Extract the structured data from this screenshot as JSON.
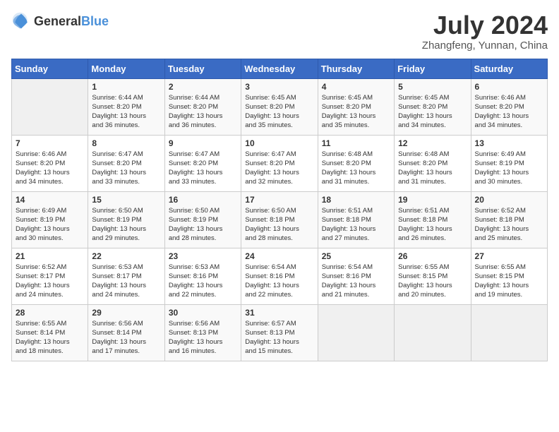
{
  "header": {
    "logo_general": "General",
    "logo_blue": "Blue",
    "month_year": "July 2024",
    "location": "Zhangfeng, Yunnan, China"
  },
  "days_of_week": [
    "Sunday",
    "Monday",
    "Tuesday",
    "Wednesday",
    "Thursday",
    "Friday",
    "Saturday"
  ],
  "weeks": [
    [
      {
        "day": "",
        "info": ""
      },
      {
        "day": "1",
        "info": "Sunrise: 6:44 AM\nSunset: 8:20 PM\nDaylight: 13 hours\nand 36 minutes."
      },
      {
        "day": "2",
        "info": "Sunrise: 6:44 AM\nSunset: 8:20 PM\nDaylight: 13 hours\nand 36 minutes."
      },
      {
        "day": "3",
        "info": "Sunrise: 6:45 AM\nSunset: 8:20 PM\nDaylight: 13 hours\nand 35 minutes."
      },
      {
        "day": "4",
        "info": "Sunrise: 6:45 AM\nSunset: 8:20 PM\nDaylight: 13 hours\nand 35 minutes."
      },
      {
        "day": "5",
        "info": "Sunrise: 6:45 AM\nSunset: 8:20 PM\nDaylight: 13 hours\nand 34 minutes."
      },
      {
        "day": "6",
        "info": "Sunrise: 6:46 AM\nSunset: 8:20 PM\nDaylight: 13 hours\nand 34 minutes."
      }
    ],
    [
      {
        "day": "7",
        "info": "Sunrise: 6:46 AM\nSunset: 8:20 PM\nDaylight: 13 hours\nand 34 minutes."
      },
      {
        "day": "8",
        "info": "Sunrise: 6:47 AM\nSunset: 8:20 PM\nDaylight: 13 hours\nand 33 minutes."
      },
      {
        "day": "9",
        "info": "Sunrise: 6:47 AM\nSunset: 8:20 PM\nDaylight: 13 hours\nand 33 minutes."
      },
      {
        "day": "10",
        "info": "Sunrise: 6:47 AM\nSunset: 8:20 PM\nDaylight: 13 hours\nand 32 minutes."
      },
      {
        "day": "11",
        "info": "Sunrise: 6:48 AM\nSunset: 8:20 PM\nDaylight: 13 hours\nand 31 minutes."
      },
      {
        "day": "12",
        "info": "Sunrise: 6:48 AM\nSunset: 8:20 PM\nDaylight: 13 hours\nand 31 minutes."
      },
      {
        "day": "13",
        "info": "Sunrise: 6:49 AM\nSunset: 8:19 PM\nDaylight: 13 hours\nand 30 minutes."
      }
    ],
    [
      {
        "day": "14",
        "info": "Sunrise: 6:49 AM\nSunset: 8:19 PM\nDaylight: 13 hours\nand 30 minutes."
      },
      {
        "day": "15",
        "info": "Sunrise: 6:50 AM\nSunset: 8:19 PM\nDaylight: 13 hours\nand 29 minutes."
      },
      {
        "day": "16",
        "info": "Sunrise: 6:50 AM\nSunset: 8:19 PM\nDaylight: 13 hours\nand 28 minutes."
      },
      {
        "day": "17",
        "info": "Sunrise: 6:50 AM\nSunset: 8:18 PM\nDaylight: 13 hours\nand 28 minutes."
      },
      {
        "day": "18",
        "info": "Sunrise: 6:51 AM\nSunset: 8:18 PM\nDaylight: 13 hours\nand 27 minutes."
      },
      {
        "day": "19",
        "info": "Sunrise: 6:51 AM\nSunset: 8:18 PM\nDaylight: 13 hours\nand 26 minutes."
      },
      {
        "day": "20",
        "info": "Sunrise: 6:52 AM\nSunset: 8:18 PM\nDaylight: 13 hours\nand 25 minutes."
      }
    ],
    [
      {
        "day": "21",
        "info": "Sunrise: 6:52 AM\nSunset: 8:17 PM\nDaylight: 13 hours\nand 24 minutes."
      },
      {
        "day": "22",
        "info": "Sunrise: 6:53 AM\nSunset: 8:17 PM\nDaylight: 13 hours\nand 24 minutes."
      },
      {
        "day": "23",
        "info": "Sunrise: 6:53 AM\nSunset: 8:16 PM\nDaylight: 13 hours\nand 22 minutes."
      },
      {
        "day": "24",
        "info": "Sunrise: 6:54 AM\nSunset: 8:16 PM\nDaylight: 13 hours\nand 22 minutes."
      },
      {
        "day": "25",
        "info": "Sunrise: 6:54 AM\nSunset: 8:16 PM\nDaylight: 13 hours\nand 21 minutes."
      },
      {
        "day": "26",
        "info": "Sunrise: 6:55 AM\nSunset: 8:15 PM\nDaylight: 13 hours\nand 20 minutes."
      },
      {
        "day": "27",
        "info": "Sunrise: 6:55 AM\nSunset: 8:15 PM\nDaylight: 13 hours\nand 19 minutes."
      }
    ],
    [
      {
        "day": "28",
        "info": "Sunrise: 6:55 AM\nSunset: 8:14 PM\nDaylight: 13 hours\nand 18 minutes."
      },
      {
        "day": "29",
        "info": "Sunrise: 6:56 AM\nSunset: 8:14 PM\nDaylight: 13 hours\nand 17 minutes."
      },
      {
        "day": "30",
        "info": "Sunrise: 6:56 AM\nSunset: 8:13 PM\nDaylight: 13 hours\nand 16 minutes."
      },
      {
        "day": "31",
        "info": "Sunrise: 6:57 AM\nSunset: 8:13 PM\nDaylight: 13 hours\nand 15 minutes."
      },
      {
        "day": "",
        "info": ""
      },
      {
        "day": "",
        "info": ""
      },
      {
        "day": "",
        "info": ""
      }
    ]
  ]
}
